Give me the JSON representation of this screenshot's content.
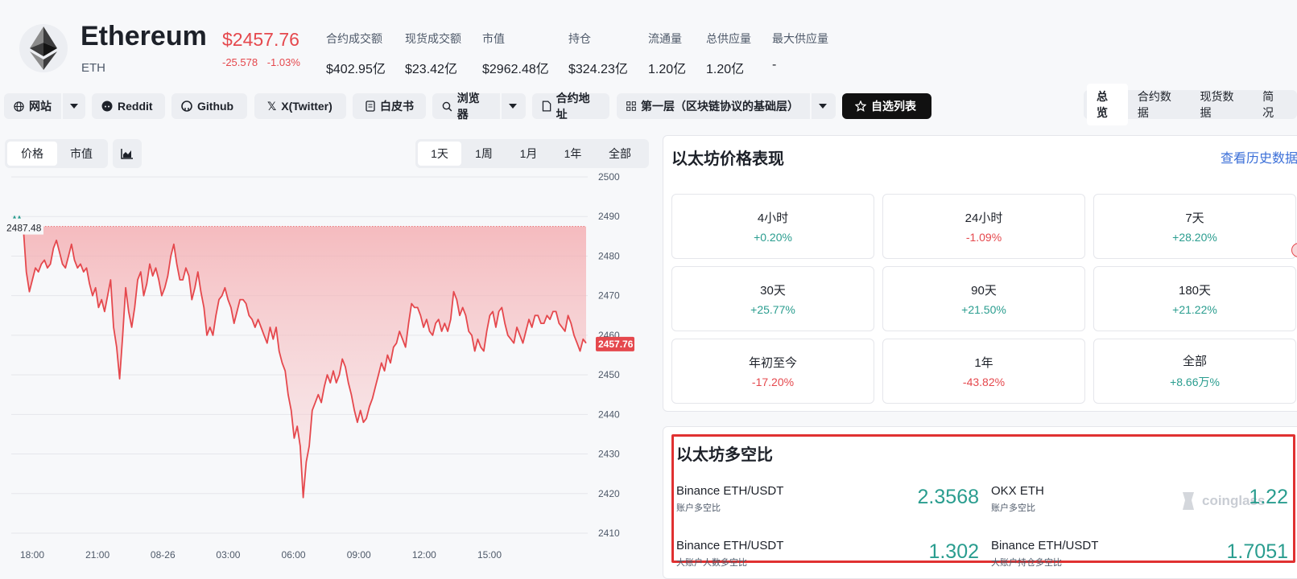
{
  "coin": {
    "name": "Ethereum",
    "symbol": "ETH",
    "price": "$2457.76",
    "change_abs": "-25.578",
    "change_pct": "-1.03%"
  },
  "stats": [
    {
      "label": "合约成交额",
      "value": "$402.95亿"
    },
    {
      "label": "现货成交额",
      "value": "$23.42亿"
    },
    {
      "label": "市值",
      "value": "$2962.48亿"
    },
    {
      "label": "持仓",
      "value": "$324.23亿"
    },
    {
      "label": "流通量",
      "value": "1.20亿"
    },
    {
      "label": "总供应量",
      "value": "1.20亿"
    },
    {
      "label": "最大供应量",
      "value": "-"
    }
  ],
  "toolbar": {
    "website": "网站",
    "reddit": "Reddit",
    "github": "Github",
    "twitter": "X(Twitter)",
    "whitepaper": "白皮书",
    "explorer": "浏览器",
    "contract": "合约地址",
    "category": "第一层（区块链协议的基础层）",
    "watchlist": "自选列表"
  },
  "main_tabs": [
    "总览",
    "合约数据",
    "现货数据",
    "简况"
  ],
  "chart_controls": {
    "metric_tabs": [
      "价格",
      "市值"
    ],
    "range_tabs": [
      "1天",
      "1周",
      "1月",
      "1年",
      "全部"
    ]
  },
  "chart_data": {
    "type": "area",
    "title": "",
    "xlabel": "",
    "ylabel": "",
    "x_ticks": [
      "18:00",
      "21:00",
      "08-26",
      "03:00",
      "06:00",
      "09:00",
      "12:00",
      "15:00"
    ],
    "ylim": [
      2410,
      2500
    ],
    "y_ticks": [
      2410,
      2420,
      2430,
      2440,
      2450,
      2460,
      2470,
      2480,
      2490,
      2500
    ],
    "high_label": "2487.48",
    "current_label": "2457.76",
    "series": [
      {
        "values": [
          2487,
          2476,
          2471,
          2474,
          2477,
          2476,
          2478,
          2479,
          2477,
          2478,
          2482,
          2484,
          2481,
          2478,
          2477,
          2480,
          2483,
          2479,
          2477,
          2478,
          2476,
          2477,
          2473,
          2470,
          2472,
          2467,
          2469,
          2466,
          2470,
          2474,
          2462,
          2457,
          2449,
          2460,
          2472,
          2466,
          2462,
          2467,
          2474,
          2476,
          2470,
          2473,
          2478,
          2475,
          2477,
          2474,
          2470,
          2472,
          2475,
          2480,
          2483,
          2478,
          2474,
          2474,
          2477,
          2475,
          2469,
          2472,
          2476,
          2471,
          2467,
          2460,
          2462,
          2460,
          2465,
          2469,
          2470,
          2472,
          2469,
          2467,
          2463,
          2466,
          2469,
          2469,
          2468,
          2465,
          2464,
          2462,
          2464,
          2462,
          2460,
          2458,
          2462,
          2459,
          2462,
          2456,
          2453,
          2451,
          2445,
          2441,
          2434,
          2437,
          2432,
          2419,
          2428,
          2432,
          2441,
          2443,
          2445,
          2443,
          2447,
          2450,
          2448,
          2451,
          2448,
          2450,
          2454,
          2452,
          2448,
          2445,
          2441,
          2438,
          2441,
          2438,
          2439,
          2442,
          2444,
          2447,
          2450,
          2453,
          2451,
          2455,
          2453,
          2457,
          2458,
          2461,
          2459,
          2457,
          2463,
          2468,
          2467,
          2467,
          2465,
          2462,
          2464,
          2461,
          2460,
          2463,
          2464,
          2461,
          2463,
          2461,
          2464,
          2471,
          2469,
          2465,
          2467,
          2465,
          2461,
          2460,
          2456,
          2459,
          2457,
          2456,
          2461,
          2465,
          2466,
          2462,
          2466,
          2467,
          2463,
          2460,
          2459,
          2458,
          2462,
          2460,
          2458,
          2461,
          2464,
          2462,
          2465,
          2465,
          2463,
          2463,
          2465,
          2464,
          2466,
          2466,
          2463,
          2462,
          2461,
          2465,
          2463,
          2460,
          2458,
          2456,
          2459,
          2458
        ]
      }
    ]
  },
  "performance": {
    "title": "以太坊价格表现",
    "history_link": "查看历史数据",
    "cells": [
      {
        "period": "4小时",
        "value": "+0.20%",
        "dir": "up"
      },
      {
        "period": "24小时",
        "value": "-1.09%",
        "dir": "down"
      },
      {
        "period": "7天",
        "value": "+28.20%",
        "dir": "up"
      },
      {
        "period": "30天",
        "value": "+25.77%",
        "dir": "up"
      },
      {
        "period": "90天",
        "value": "+21.50%",
        "dir": "up"
      },
      {
        "period": "180天",
        "value": "+21.22%",
        "dir": "up"
      },
      {
        "period": "年初至今",
        "value": "-17.20%",
        "dir": "down"
      },
      {
        "period": "1年",
        "value": "-43.82%",
        "dir": "down"
      },
      {
        "period": "全部",
        "value": "+8.66万%",
        "dir": "up"
      }
    ]
  },
  "long_short": {
    "title": "以太坊多空比",
    "watermark": "coinglass",
    "items": [
      {
        "exchange": "Binance ETH/USDT",
        "metric": "账户多空比",
        "value": "2.3568"
      },
      {
        "exchange": "OKX ETH",
        "metric": "账户多空比",
        "value": "1.22"
      },
      {
        "exchange": "Binance ETH/USDT",
        "metric": "大账户人数多空比",
        "value": "1.302"
      },
      {
        "exchange": "Binance ETH/USDT",
        "metric": "大账户持仓多空比",
        "value": "1.7051"
      }
    ]
  }
}
